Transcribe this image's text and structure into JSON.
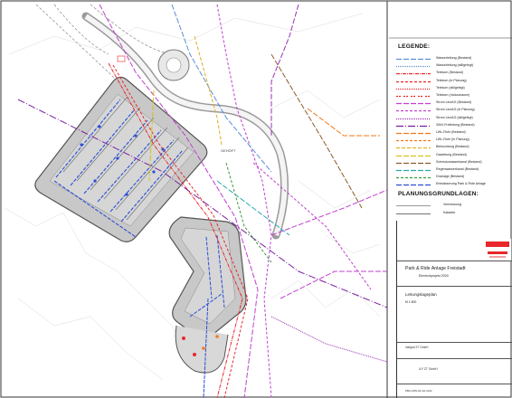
{
  "legend": {
    "heading": "LEGENDE:",
    "items": [
      {
        "label": "Wasserleitung (Bestand)",
        "color": "#5a8fd6",
        "dash": "6 2"
      },
      {
        "label": "Wasserleitung (stillgelegt)",
        "color": "#5a8fd6",
        "dash": "1 1"
      },
      {
        "label": "Telekom (Bestand)",
        "color": "#e8262b",
        "dash": "4 1 1 1"
      },
      {
        "label": "Telekom (in Planung)",
        "color": "#e8262b",
        "dash": "3 2"
      },
      {
        "label": "Telekom (stillgelegt)",
        "color": "#e8262b",
        "dash": "1 1"
      },
      {
        "label": "Telekom (rückzubauen)",
        "color": "#e8262b",
        "dash": "2 1 2 3"
      },
      {
        "label": "Strom LinzAG (Bestand)",
        "color": "#c040d0",
        "dash": "6 2"
      },
      {
        "label": "Strom LinzAG (in Planung)",
        "color": "#c040d0",
        "dash": "3 2"
      },
      {
        "label": "Strom LinzAG (stillgelegt)",
        "color": "#9b30b8",
        "dash": "1 1"
      },
      {
        "label": "30kV-Freileitung (Bestand)",
        "color": "#7a1fa0",
        "dash": "8 2 1 2"
      },
      {
        "label": "LWL-Rohr (Bestand)",
        "color": "#f07a1a",
        "dash": "6 2"
      },
      {
        "label": "LWL-Rohr (In Planung)",
        "color": "#f07a1a",
        "dash": "3 2"
      },
      {
        "label": "Beleuchtung (Bestand)",
        "color": "#e0b020",
        "dash": "4 2"
      },
      {
        "label": "Gasleitung (Bestand)",
        "color": "#d4c21c",
        "dash": "6 2"
      },
      {
        "label": "Schmutzwasserkanal (Bestand)",
        "color": "#8b5a2b",
        "dash": "6 2"
      },
      {
        "label": "Regenwasserkanal (Bestand)",
        "color": "#2aa8b0",
        "dash": "6 2"
      },
      {
        "label": "Drainage (Bestand)",
        "color": "#3a9a3a",
        "dash": "3 2"
      },
      {
        "label": "Entwässerung Park & Ride Anlage",
        "color": "#2a4fd6",
        "dash": "6 2"
      }
    ]
  },
  "planning": {
    "heading": "PLANUNGSGRUNDLAGEN:",
    "items": [
      {
        "label": "Vermessung",
        "color": "#777777"
      },
      {
        "label": "Kataster",
        "color": "#444444"
      }
    ]
  },
  "titleblock": {
    "project_title": "Park & Ride Anlage Freistadt",
    "project_subtitle": "Einreichprojekt 2020",
    "plan_title": "Leitungslageplan",
    "scale": "M 1:500",
    "firm1": "Integral ZT GmbH",
    "firm2": "ILF ZT GmbH",
    "plan_no": "PBA-FRS-02-VA-1102"
  },
  "map": {
    "building_label": "GEHÖFT"
  },
  "colors": {
    "parking_fill": "#c8c8c8",
    "parking_border": "#555555",
    "road": "#9a9a9a",
    "drainage": "#2a4fd6",
    "telekom": "#e8262b",
    "strom": "#c040d0",
    "water": "#5a8fd6",
    "grid": "#a0a0a0"
  }
}
